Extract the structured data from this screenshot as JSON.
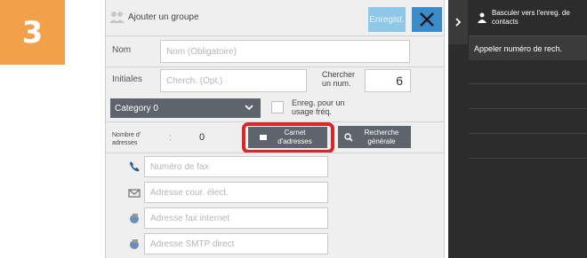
{
  "step": {
    "number": "3"
  },
  "header": {
    "title": "Ajouter un groupe",
    "save_label": "Enregist.",
    "close_label": "Fermer"
  },
  "fields": {
    "nom_label": "Nom",
    "nom_placeholder": "Nom (Obligatoire)",
    "initiales_label": "Initiales",
    "initiales_placeholder": "Cherch. (Opt.)",
    "chercher_label": "Chercher un num.",
    "chercher_value": "6"
  },
  "category": {
    "selected": "Category 0"
  },
  "usage": {
    "label": "Enreg. pour un usage fréq.",
    "checked": false
  },
  "address_count": {
    "label": "Nombre d' adresses",
    "separator": ":",
    "value": "0"
  },
  "buttons": {
    "carnet": "Carnet d'adresses",
    "recherche": "Recherche générale"
  },
  "contacts": [
    {
      "icon": "phone-icon",
      "placeholder": "Numéro de fax"
    },
    {
      "icon": "envelope-icon",
      "placeholder": "Adresse cour. élect."
    },
    {
      "icon": "globe-fax-icon",
      "placeholder": "Adresse fax internet"
    },
    {
      "icon": "globe-smtp-icon",
      "placeholder": "Adresse SMTP direct"
    }
  ],
  "side_panel": {
    "switch_label": "Basculer vers l'enreg. de contacts",
    "call_label": "Appeler numéro de rech."
  },
  "colors": {
    "badge": "#f2a04a",
    "highlight": "#d8262c",
    "accent": "#3a8bc9"
  }
}
